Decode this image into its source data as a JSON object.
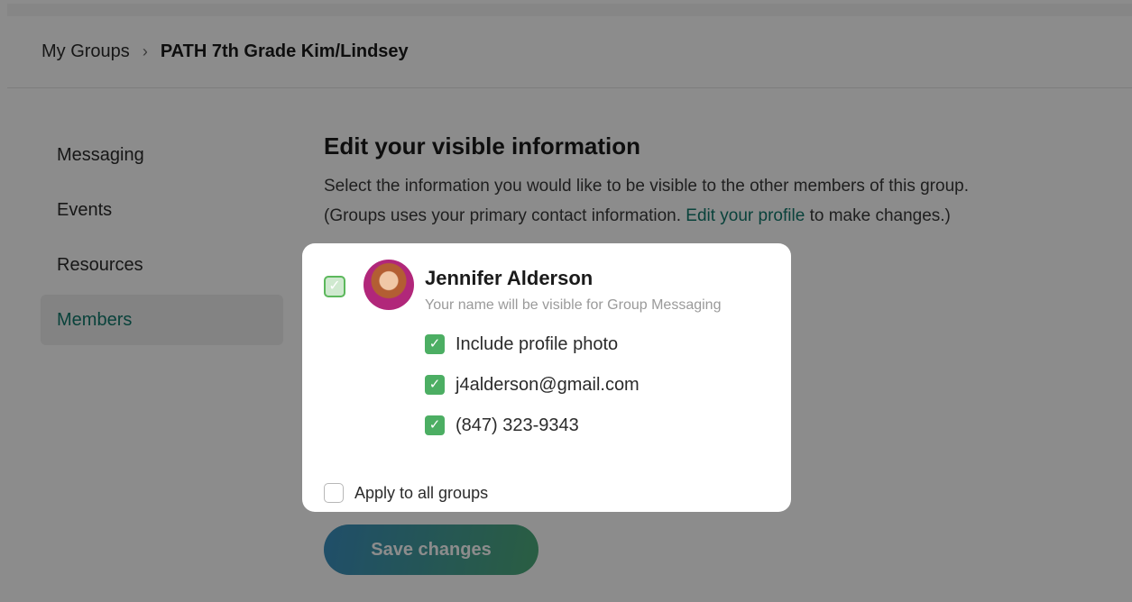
{
  "breadcrumb": {
    "parent": "My Groups",
    "separator": "›",
    "current": "PATH 7th Grade Kim/Lindsey"
  },
  "sidebar": {
    "items": [
      {
        "label": "Messaging"
      },
      {
        "label": "Events"
      },
      {
        "label": "Resources"
      },
      {
        "label": "Members",
        "active": true
      }
    ]
  },
  "main": {
    "title": "Edit your visible information",
    "desc_line1": "Select the information you would like to be visible to the other members of this group.",
    "desc_line2_before": "(Groups uses your primary contact information.",
    "desc_link": "Edit your profile",
    "desc_line2_after": "to make changes.)",
    "save_label": "Save changes"
  },
  "modal": {
    "name": "Jennifer Alderson",
    "name_note": "Your name will be visible for Group Messaging",
    "options": [
      {
        "label": "Include profile photo",
        "checked": true
      },
      {
        "label": "j4alderson@gmail.com",
        "checked": true
      },
      {
        "label": "(847) 323-9343",
        "checked": true
      }
    ],
    "apply_all_label": "Apply to all groups",
    "apply_all_checked": false
  },
  "colors": {
    "accent": "#12796c",
    "check_green": "#4cae63",
    "overlay": "rgba(0,0,0,0.45)"
  },
  "icons": {
    "checkmark": "check-icon",
    "breadcrumb_separator": "chevron-right-icon",
    "avatar": "profile-photo"
  }
}
